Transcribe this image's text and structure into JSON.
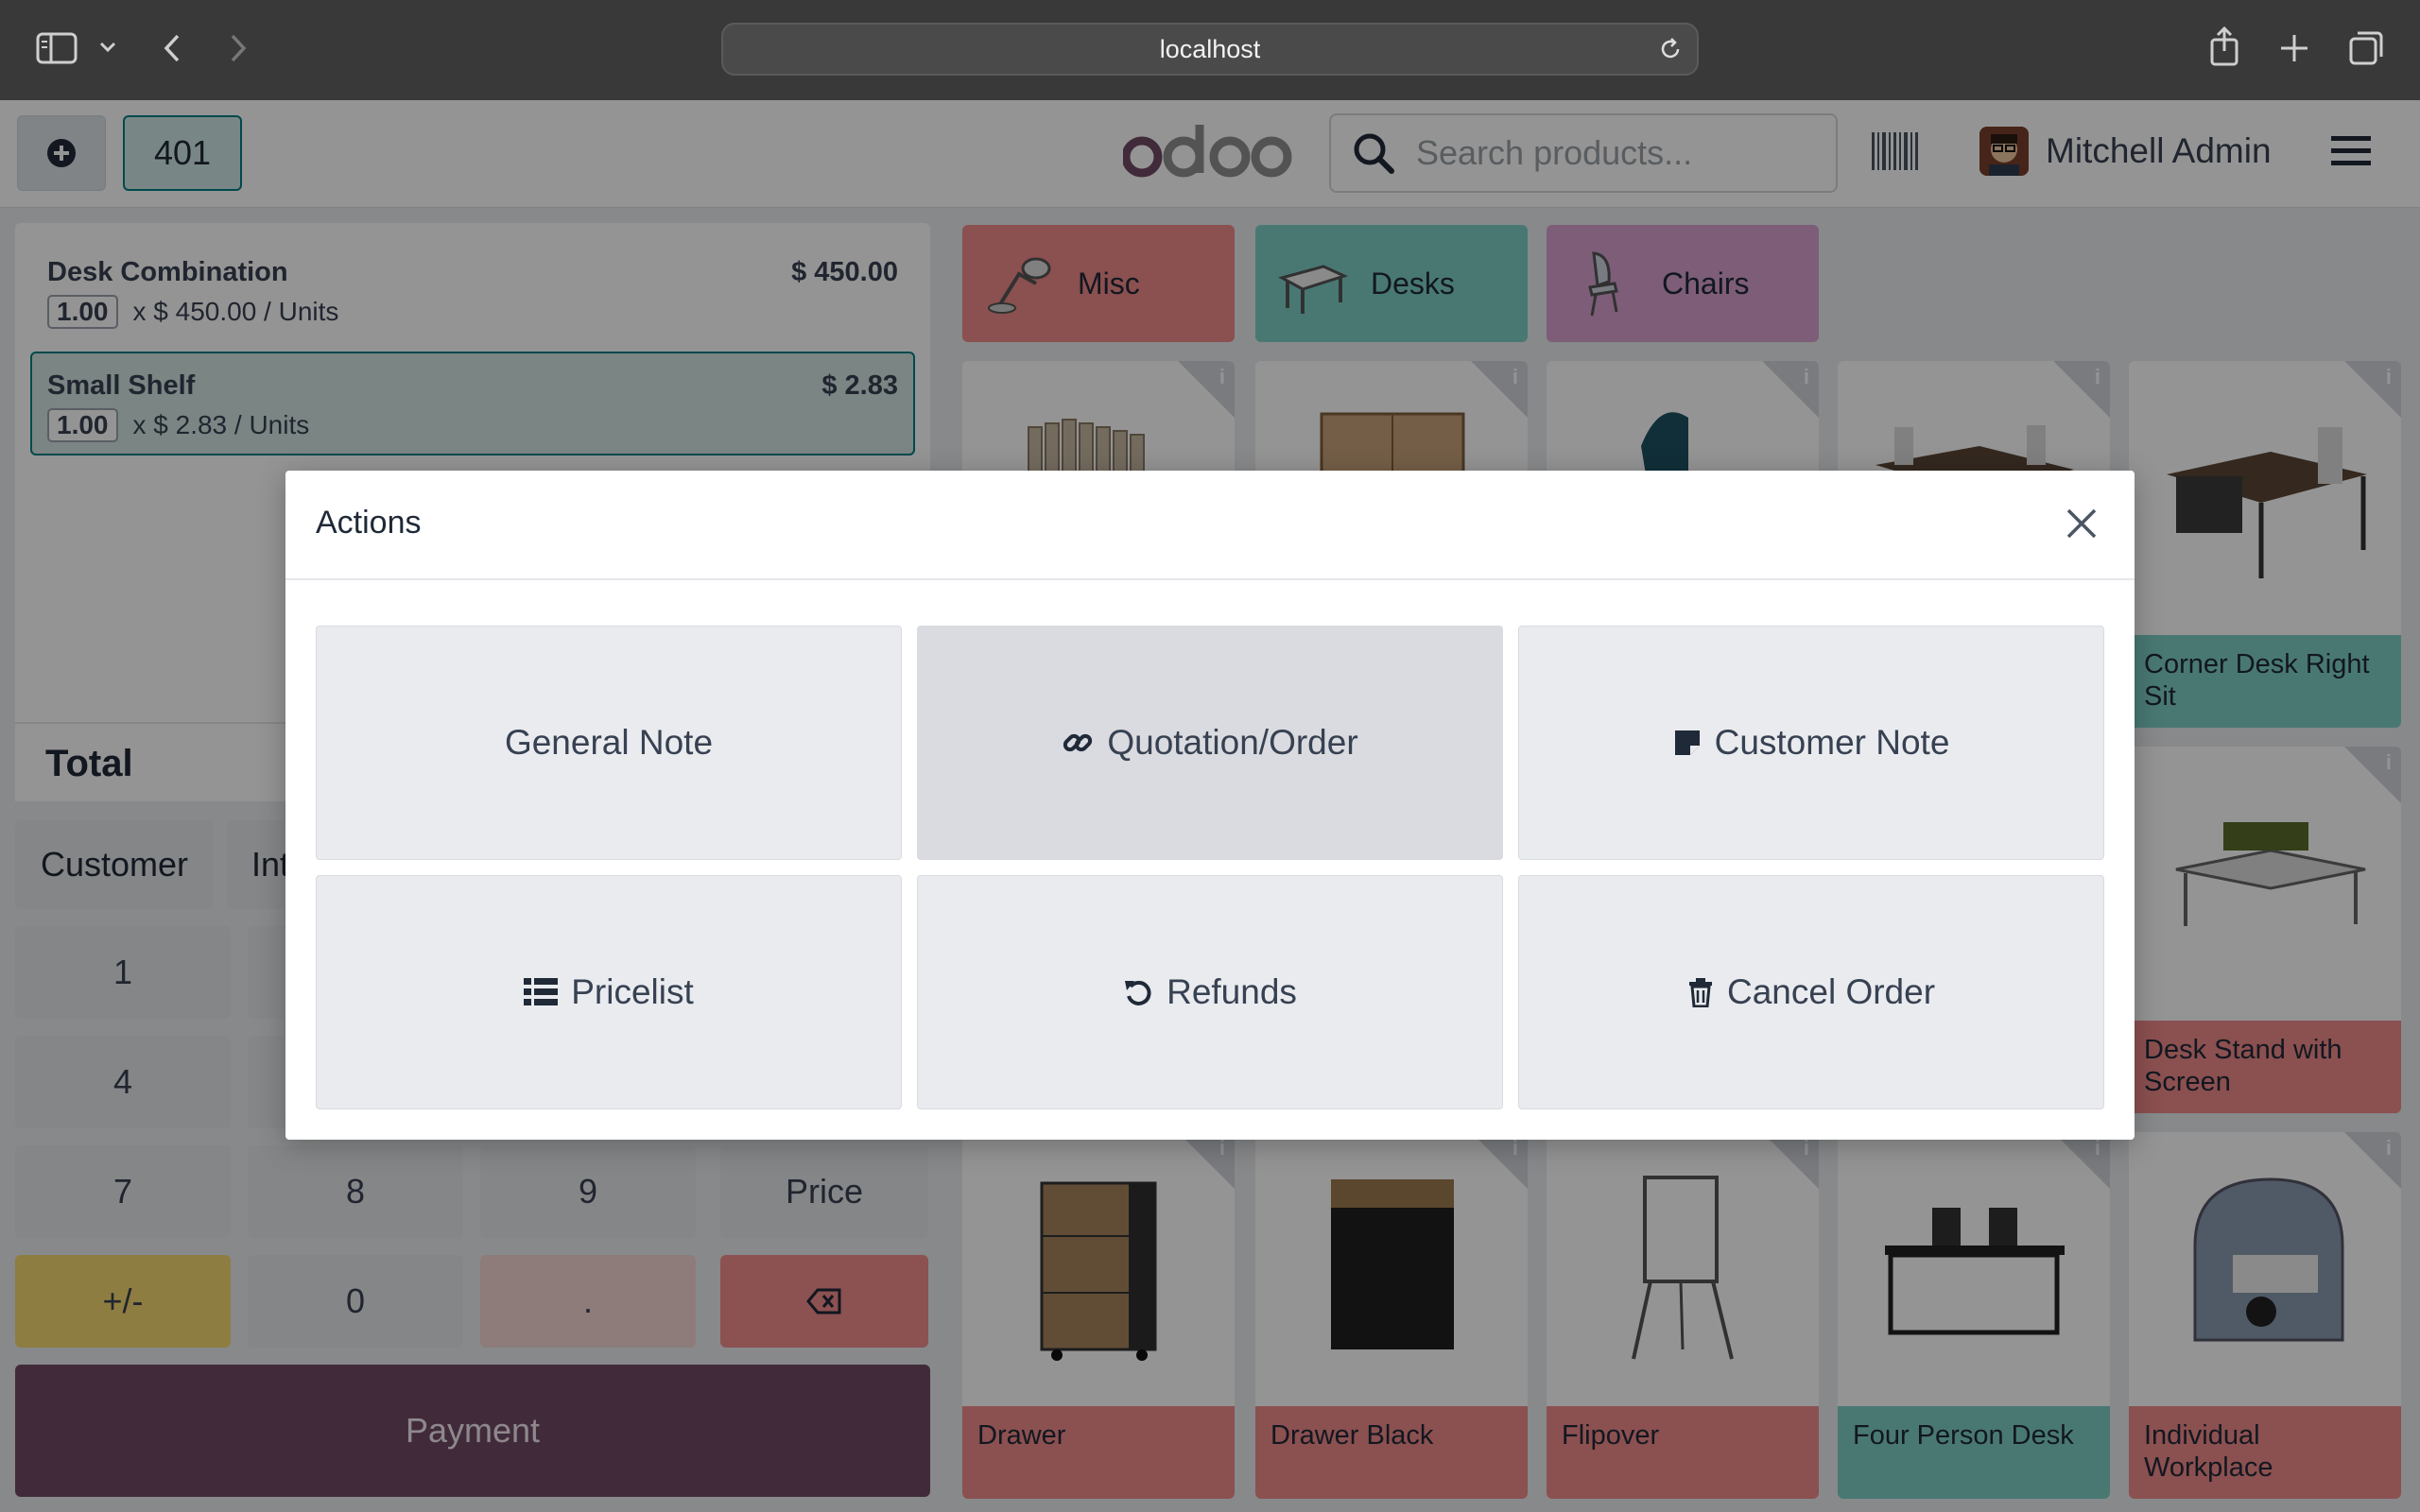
{
  "browser": {
    "url": "localhost"
  },
  "header": {
    "order_number": "401",
    "search_placeholder": "Search products...",
    "user_name": "Mitchell Admin"
  },
  "order": {
    "lines": [
      {
        "name": "Desk Combination",
        "price": "$ 450.00",
        "qty": "1.00",
        "unit_info": "x $ 450.00 / Units"
      },
      {
        "name": "Small Shelf",
        "price": "$ 2.83",
        "qty": "1.00",
        "unit_info": "x $ 2.83 / Units"
      }
    ],
    "total_label": "Total"
  },
  "controls": {
    "customer_label": "Customer",
    "internal_label": "Int",
    "numpad": [
      "1",
      "4",
      "7",
      "8",
      "9",
      "Price",
      "+/-",
      "0",
      "."
    ],
    "payment_label": "Payment"
  },
  "categories": [
    {
      "label": "Misc",
      "color": "#e9a0a0"
    },
    {
      "label": "Desks",
      "color": "#8fd1c9"
    },
    {
      "label": "Chairs",
      "color": "#d6a3cf"
    }
  ],
  "products": [
    {
      "name": "Corner Desk Right Sit"
    },
    {
      "name": "Desk Stand with Screen"
    },
    {
      "name": "Drawer"
    },
    {
      "name": "Drawer Black"
    },
    {
      "name": "Flipover"
    },
    {
      "name": "Four Person Desk"
    },
    {
      "name": "Individual Workplace"
    }
  ],
  "modal": {
    "title": "Actions",
    "buttons": [
      {
        "label": "General Note",
        "icon": "none"
      },
      {
        "label": "Quotation/Order",
        "icon": "link-icon"
      },
      {
        "label": "Customer Note",
        "icon": "sticky-note-icon"
      },
      {
        "label": "Pricelist",
        "icon": "list-icon"
      },
      {
        "label": "Refunds",
        "icon": "undo-icon"
      },
      {
        "label": "Cancel Order",
        "icon": "trash-icon"
      }
    ]
  },
  "colors": {
    "accent": "#017e84",
    "payment": "#714b67",
    "product_red": "#f08080",
    "product_teal": "#7fcfc6"
  }
}
